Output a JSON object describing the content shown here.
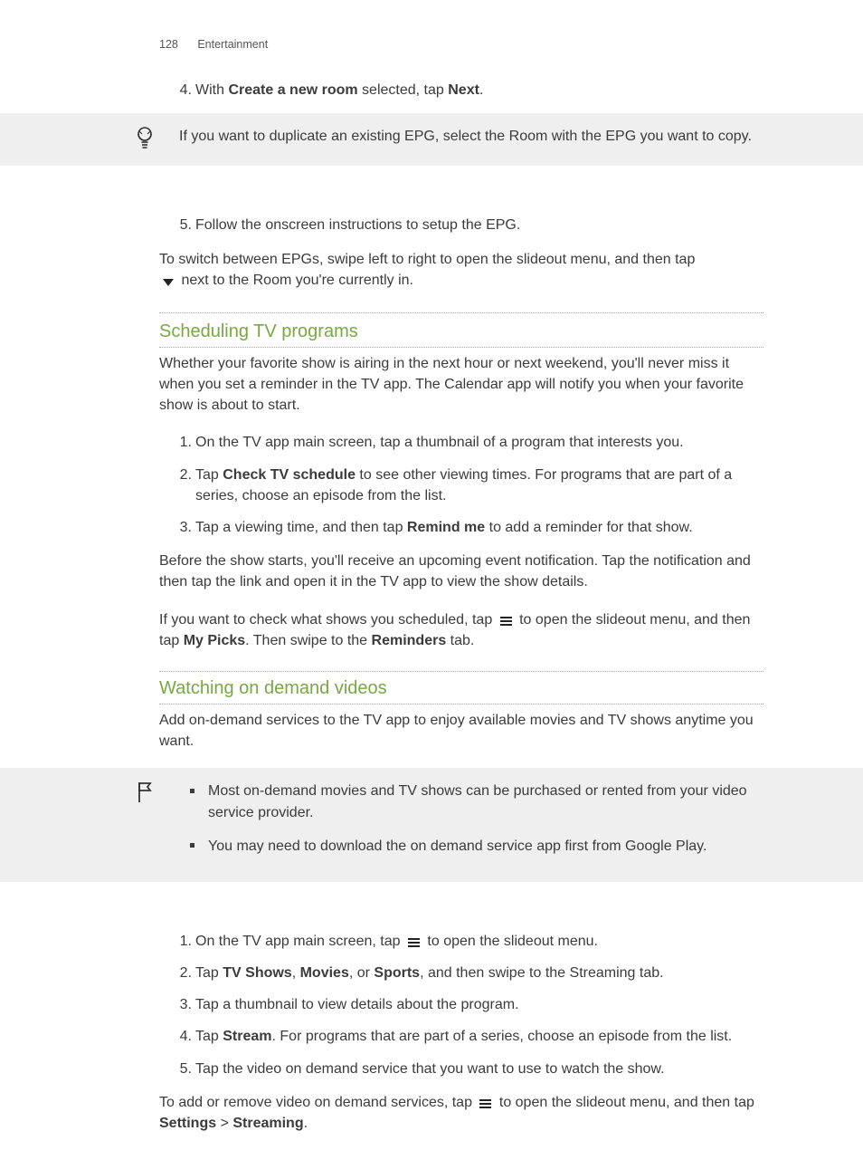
{
  "header": {
    "page_number": "128",
    "section": "Entertainment"
  },
  "step4": {
    "num": "4.",
    "pre": "With ",
    "bold1": "Create a new room",
    "mid": " selected, tap ",
    "bold2": "Next",
    "post": "."
  },
  "tip1": {
    "text": "If you want to duplicate an existing EPG, select the Room with the EPG you want to copy."
  },
  "step5": {
    "num": "5.",
    "text": "Follow the onscreen instructions to setup the EPG."
  },
  "switch_epg": {
    "line1": "To switch between EPGs, swipe left to right to open the slideout menu, and then tap",
    "line2": " next to the Room you're currently in."
  },
  "sec_schedule": {
    "title": "Scheduling TV programs",
    "intro": "Whether your favorite show is airing in the next hour or next weekend, you'll never miss it when you set a reminder in the TV app. The Calendar app will notify you when your favorite show is about to start.",
    "step1": {
      "num": "1.",
      "text": "On the TV app main screen, tap a thumbnail of a program that interests you."
    },
    "step2": {
      "num": "2.",
      "pre": "Tap ",
      "bold1": "Check TV schedule",
      "post": " to see other viewing times. For programs that are part of a series, choose an episode from the list."
    },
    "step3": {
      "num": "3.",
      "pre": "Tap a viewing time, and then tap ",
      "bold1": "Remind me",
      "post": " to add a reminder for that show."
    },
    "after": "Before the show starts, you'll receive an upcoming event notification. Tap the notification and then tap the link and open it in the TV app to view the show details.",
    "check": {
      "pre": "If you want to check what shows you scheduled, tap ",
      "mid1": " to open the slideout menu, and then tap ",
      "bold1": "My Picks",
      "mid2": ". Then swipe to the ",
      "bold2": "Reminders",
      "post": " tab."
    }
  },
  "sec_ondemand": {
    "title": "Watching on demand videos",
    "intro": "Add on-demand services to the TV app to enjoy available movies and TV shows anytime you want.",
    "note": {
      "b1": "Most on-demand movies and TV shows can be purchased or rented from your video service provider.",
      "b2": "You may need to download the on demand service app first from Google Play."
    },
    "step1": {
      "num": "1.",
      "pre": "On the TV app main screen, tap ",
      "post": " to open the slideout menu."
    },
    "step2": {
      "num": "2.",
      "pre": "Tap ",
      "b1": "TV Shows",
      "c1": ", ",
      "b2": "Movies",
      "c2": ", or ",
      "b3": "Sports",
      "post": ", and then swipe to the Streaming tab."
    },
    "step3": {
      "num": "3.",
      "text": "Tap a thumbnail to view details about the program."
    },
    "step4": {
      "num": "4.",
      "pre": "Tap ",
      "b1": "Stream",
      "post": ". For programs that are part of a series, choose an episode from the list."
    },
    "step5": {
      "num": "5.",
      "text": "Tap the video on demand service that you want to use to watch the show."
    },
    "outro": {
      "pre": "To add or remove video on demand services, tap ",
      "mid": " to open the slideout menu, and then tap ",
      "b1": "Settings",
      "gt": " > ",
      "b2": "Streaming",
      "post": "."
    }
  }
}
